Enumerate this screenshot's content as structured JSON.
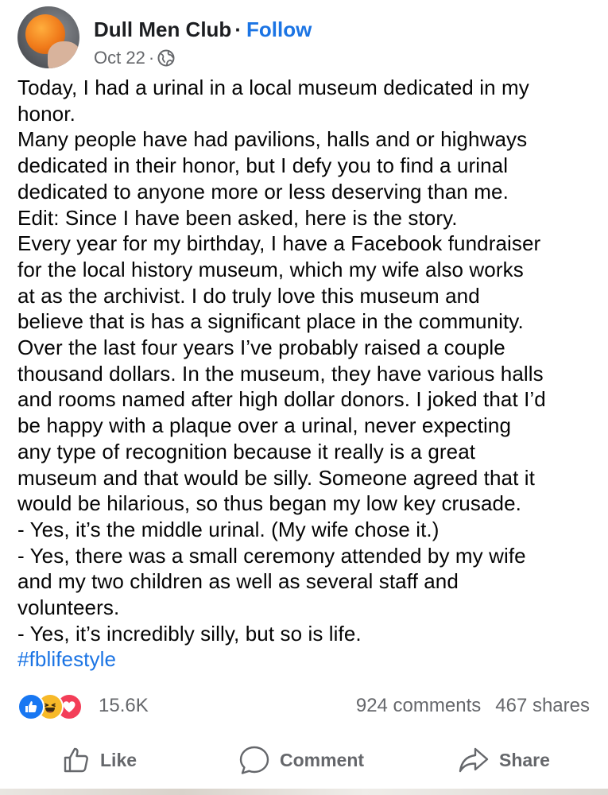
{
  "post": {
    "author": "Dull Men Club",
    "separator": "·",
    "follow_label": "Follow",
    "date": "Oct 22",
    "meta_separator": "·",
    "privacy_icon": "globe-icon",
    "body_lines": [
      "Today, I had a urinal in a local museum dedicated in my",
      "honor.",
      "Many people have had pavilions, halls and or highways",
      "dedicated in their honor, but I defy you to find a urinal",
      "dedicated to anyone more or less deserving than me.",
      "Edit: Since I have been asked, here is the story.",
      "Every year for my birthday, I have a Facebook fundraiser",
      "for the local history museum, which my wife also works",
      "at as the archivist. I do truly love this museum and",
      "believe that is has a significant place in the community.",
      "Over the last four years I’ve probably raised a couple",
      "thousand dollars. In the museum, they have various halls",
      "and rooms named after high dollar donors. I joked that I’d",
      "be happy with a plaque over a urinal, never expecting",
      "any type of recognition because it really is a great",
      "museum and that would be silly. Someone agreed that it",
      "would be hilarious, so thus began my low key crusade.",
      "- Yes, it’s the middle urinal. (My wife chose it.)",
      "- Yes, there was a small ceremony attended by my wife",
      "and my two children as well as several staff and",
      "volunteers.",
      "- Yes, it’s incredibly silly, but so is life."
    ],
    "hashtag": "#fblifestyle"
  },
  "engagement": {
    "reactions": [
      "like-reaction-icon",
      "haha-reaction-icon",
      "love-reaction-icon"
    ],
    "reaction_count": "15.6K",
    "comments": "924 comments",
    "shares": "467 shares"
  },
  "actions": {
    "like_label": "Like",
    "comment_label": "Comment",
    "share_label": "Share"
  },
  "colors": {
    "accent": "#1b74e4",
    "muted_text": "#65676b",
    "like": "#1877f2",
    "haha": "#f7b928",
    "love": "#f33e58"
  }
}
